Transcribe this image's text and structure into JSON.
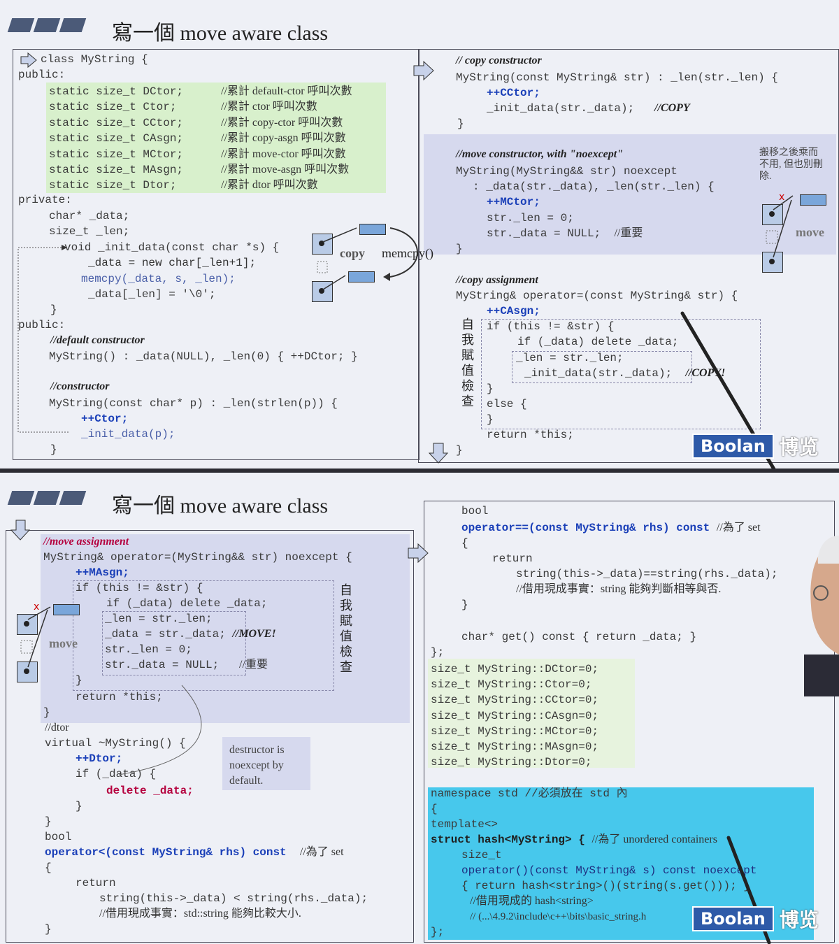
{
  "slide1": {
    "title": "寫一個 move aware class",
    "left_code": {
      "l1": "class MyString {",
      "l2": "public:",
      "statics": [
        {
          "decl": "static size_t DCtor;",
          "comment": "//累計 default-ctor 呼叫次數"
        },
        {
          "decl": "static size_t Ctor;",
          "comment": "//累計 ctor 呼叫次數"
        },
        {
          "decl": "static size_t CCtor;",
          "comment": "//累計 copy-ctor 呼叫次數"
        },
        {
          "decl": "static size_t CAsgn;",
          "comment": "//累計 copy-asgn 呼叫次數"
        },
        {
          "decl": "static size_t MCtor;",
          "comment": "//累計 move-ctor 呼叫次數"
        },
        {
          "decl": "static size_t MAsgn;",
          "comment": "//累計 move-asgn 呼叫次數"
        },
        {
          "decl": "static size_t Dtor;",
          "comment": "//累計 dtor 呼叫次數"
        }
      ],
      "private": "private:",
      "p1": "char* _data;",
      "p2": "size_t _len;",
      "init1": "void _init_data(const char *s) {",
      "init2": "_data = new char[_len+1];",
      "init3": "memcpy(_data, s, _len);",
      "init4": "_data[_len] = '\\0';",
      "close": "}",
      "public2": "public:",
      "defc_comment": "//default constructor",
      "defc": "MyString() : _data(NULL), _len(0) { ++DCtor; }",
      "ctor_comment": "//constructor",
      "ctor1": "MyString(const char* p) : _len(strlen(p)) {",
      "ctor2": "++Ctor;",
      "ctor3": "_init_data(p);",
      "ctor4": "}"
    },
    "diagram": {
      "copy": "copy",
      "memcpy": "memcpy()"
    },
    "right_code": {
      "cc_comment": "// copy constructor",
      "cc1": "MyString(const MyString& str) : _len(str._len) {",
      "cc2": "++CCtor;",
      "cc3": "_init_data(str._data);",
      "cc3c": "//COPY",
      "cc4": "}",
      "mc_comment": "//move constructor, with \"noexcept\"",
      "mc1": "MyString(MyString&& str) noexcept",
      "mc2": ": _data(str._data), _len(str._len) {",
      "mc3": "++MCtor;",
      "mc4": "str._len = 0;",
      "mc5": "str._data = NULL;",
      "mc5c": "//重要",
      "mc6": "}",
      "mc_note": "搬移之後乘而不用, 但也別刪除.",
      "move": "move",
      "ca_comment": "//copy assignment",
      "ca1": "MyString& operator=(const MyString& str) {",
      "ca2": "++CAsgn;",
      "ca3": "if (this != &str) {",
      "ca4": "if (_data) delete _data;",
      "ca5": "_len = str._len;",
      "ca6": "_init_data(str._data);",
      "ca6c": "//COPY!",
      "ca7": "}",
      "ca8": "else {",
      "ca9": "}",
      "ca10": "return *this;",
      "ca11": "}",
      "self_check": "自我賦值檢查"
    },
    "logo": {
      "en": "Boolan",
      "zh": "博览"
    }
  },
  "slide2": {
    "title": "寫一個 move aware class",
    "left_code": {
      "ma_comment": "//move assignment",
      "ma1": "MyString& operator=(MyString&& str) noexcept {",
      "ma2": "++MAsgn;",
      "ma3": "if (this != &str) {",
      "ma4": "if (_data) delete _data;",
      "ma5": "_len = str._len;",
      "ma6": "_data = str._data;",
      "ma6c": "//MOVE!",
      "ma7": "str._len = 0;",
      "ma8": "str._data = NULL;",
      "ma8c": "//重要",
      "ma9": "}",
      "ma10": "return *this;",
      "ma11": "}",
      "self_check": "自我賦值檢查",
      "move": "move",
      "dtor_comment": "//dtor",
      "d1": "virtual ~MyString() {",
      "d2": "++Dtor;",
      "d3": "if (_data) {",
      "d4": "delete _data;",
      "d5": "}",
      "d6": "}",
      "dtor_note": "destructor is noexcept by default.",
      "lt1": "bool",
      "lt2": "operator<(const MyString& rhs) const",
      "lt2c": "//為了 set",
      "lt3": "{",
      "lt4": "return",
      "lt5": "string(this->_data) < string(rhs._data);",
      "lt6": "//借用現成事實：std::string 能夠比較大小.",
      "lt7": "}"
    },
    "right_code": {
      "eq1": "bool",
      "eq2": "operator==(const MyString& rhs) const",
      "eq2c": "//為了 set",
      "eq3": "{",
      "eq4": "return",
      "eq5": "string(this->_data)==string(rhs._data);",
      "eq6": "//借用現成事實：string 能夠判斷相等與否.",
      "eq7": "}",
      "get": "char* get() const { return _data; }",
      "close": "};",
      "defs": [
        "size_t MyString::DCtor=0;",
        "size_t MyString::Ctor=0;",
        "size_t MyString::CCtor=0;",
        "size_t MyString::CAsgn=0;",
        "size_t MyString::MCtor=0;",
        "size_t MyString::MAsgn=0;",
        "size_t MyString::Dtor=0;"
      ],
      "ns1": "namespace std //必須放在 std 內",
      "ns2": "{",
      "ns3": "template<>",
      "ns4": "struct hash<MyString> {",
      "ns4c": "//為了 unordered containers",
      "ns5": "size_t",
      "ns6": "operator()(const MyString& s) const noexcept",
      "ns7": "{ return hash<string>()(string(s.get())); }",
      "ns8": "//借用現成的 hash<string>",
      "ns9": "// (...\\4.9.2\\include\\c++\\bits\\basic_string.h",
      "ns10": "};"
    },
    "logo": {
      "en": "Boolan",
      "zh": "博览"
    }
  }
}
